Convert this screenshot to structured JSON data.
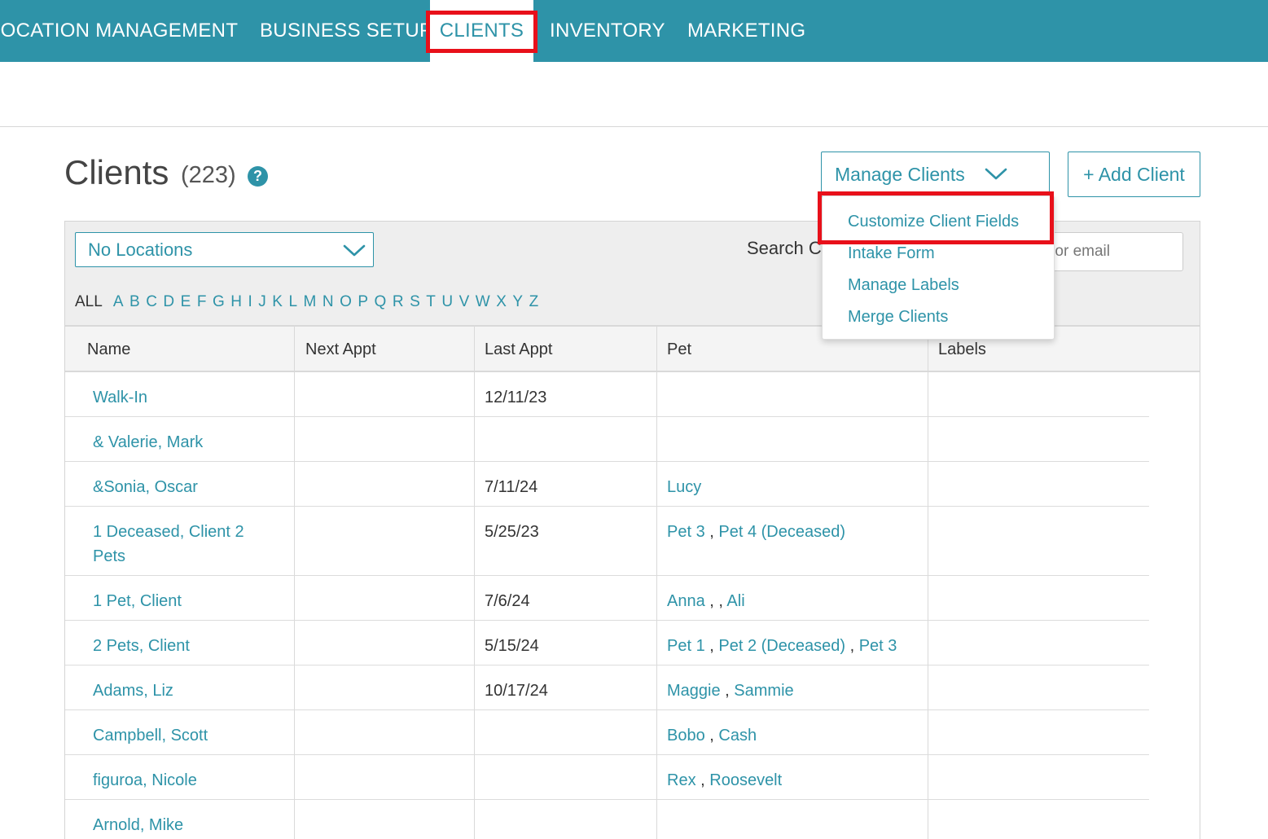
{
  "nav": {
    "items": [
      {
        "label": "LOCATION MANAGEMENT",
        "active": false
      },
      {
        "label": "BUSINESS SETUP",
        "active": false
      },
      {
        "label": "CLIENTS",
        "active": true
      },
      {
        "label": "INVENTORY",
        "active": false
      },
      {
        "label": "MARKETING",
        "active": false
      }
    ]
  },
  "header": {
    "title": "Clients",
    "count": "(223)",
    "help": "?",
    "manage_label": "Manage Clients",
    "add_label": "+ Add Client"
  },
  "menu": {
    "items": [
      {
        "label": "Customize Client Fields",
        "highlighted": true
      },
      {
        "label": "Intake Form"
      },
      {
        "label": "Manage Labels"
      },
      {
        "label": "Merge Clients"
      }
    ]
  },
  "filters": {
    "location_value": "No Locations",
    "search_label": "Search C",
    "search_placeholder": "er, or email",
    "alpha_all": "ALL",
    "letters": [
      "A",
      "B",
      "C",
      "D",
      "E",
      "F",
      "G",
      "H",
      "I",
      "J",
      "K",
      "L",
      "M",
      "N",
      "O",
      "P",
      "Q",
      "R",
      "S",
      "T",
      "U",
      "V",
      "W",
      "X",
      "Y",
      "Z"
    ]
  },
  "table": {
    "columns": [
      "Name",
      "Next Appt",
      "Last Appt",
      "Pet",
      "Labels"
    ],
    "rows": [
      {
        "name": [
          "Walk-In"
        ],
        "next": "",
        "last": "12/11/23",
        "pets": []
      },
      {
        "name": [
          "& Valerie, Mark"
        ],
        "next": "",
        "last": "",
        "pets": []
      },
      {
        "name": [
          "&Sonia, Oscar"
        ],
        "next": "",
        "last": "7/11/24",
        "pets": [
          "Lucy"
        ]
      },
      {
        "name": [
          "1 Deceased, Client 2",
          "Pets"
        ],
        "next": "",
        "last": "5/25/23",
        "pets": [
          "Pet 3",
          "Pet 4 (Deceased)"
        ]
      },
      {
        "name": [
          "1 Pet, Client"
        ],
        "next": "",
        "last": "7/6/24",
        "pets": [
          "Anna",
          "",
          "Ali"
        ]
      },
      {
        "name": [
          "2 Pets, Client"
        ],
        "next": "",
        "last": "5/15/24",
        "pets": [
          "Pet 1",
          "Pet 2 (Deceased)",
          "Pet 3"
        ]
      },
      {
        "name": [
          "Adams, Liz"
        ],
        "next": "",
        "last": "10/17/24",
        "pets": [
          "Maggie",
          "Sammie"
        ]
      },
      {
        "name": [
          "Campbell, Scott"
        ],
        "next": "",
        "last": "",
        "pets": [
          "Bobo",
          "Cash"
        ]
      },
      {
        "name": [
          "figuroa, Nicole"
        ],
        "next": "",
        "last": "",
        "pets": [
          "Rex",
          "Roosevelt"
        ]
      },
      {
        "name": [
          "Arnold, Mike"
        ],
        "next": "",
        "last": "",
        "pets": []
      }
    ]
  },
  "colors": {
    "brand": "#2e93a8",
    "highlight": "#e8101a"
  }
}
